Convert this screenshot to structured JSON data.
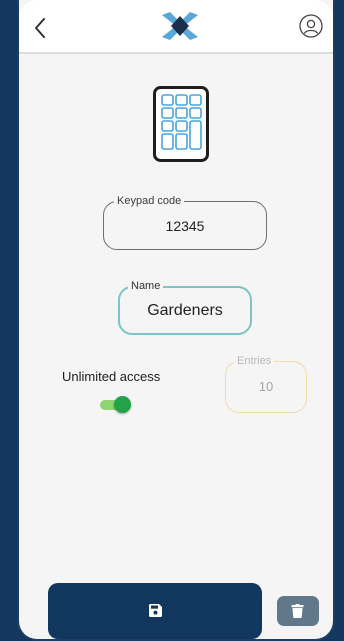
{
  "header": {
    "back_icon": "chevron-left-icon",
    "logo_icon": "brand-x-logo",
    "profile_icon": "user-circle-icon"
  },
  "hero": {
    "icon": "keypad-icon"
  },
  "keypad_code": {
    "label": "Keypad code",
    "value": "12345"
  },
  "name": {
    "label": "Name",
    "value": "Gardeners"
  },
  "access": {
    "unlimited_label": "Unlimited access",
    "unlimited_enabled": true
  },
  "entries": {
    "label": "Entries",
    "value": "10"
  },
  "actions": {
    "save_icon": "floppy-disk-icon",
    "delete_icon": "trash-icon"
  },
  "colors": {
    "primary": "#12375f",
    "teal_accent": "#7fc3c3",
    "toggle_on": "#22a34a",
    "disabled_border": "#f1dba6",
    "delete_button": "#61788a"
  }
}
